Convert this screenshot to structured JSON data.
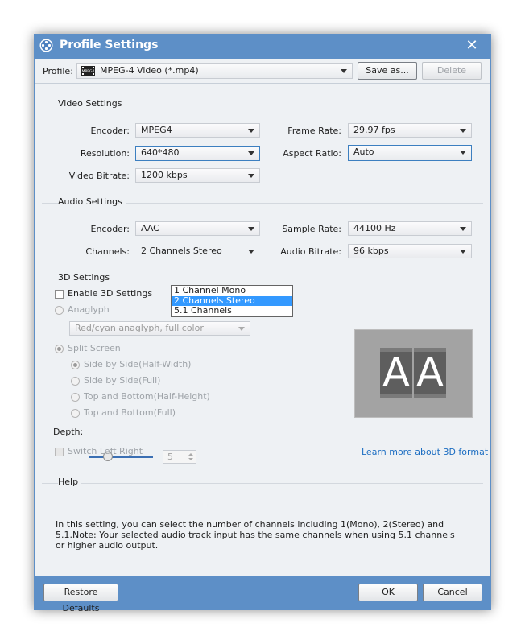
{
  "window": {
    "title": "Profile Settings"
  },
  "profile": {
    "label": "Profile:",
    "value": "MPEG-4 Video (*.mp4)",
    "icon_text": "MPEG4",
    "save_as": "Save as...",
    "delete": "Delete"
  },
  "video": {
    "title": "Video Settings",
    "encoder_label": "Encoder:",
    "encoder": "MPEG4",
    "resolution_label": "Resolution:",
    "resolution": "640*480",
    "bitrate_label": "Video Bitrate:",
    "bitrate": "1200 kbps",
    "framerate_label": "Frame Rate:",
    "framerate": "29.97 fps",
    "aspect_label": "Aspect Ratio:",
    "aspect": "Auto"
  },
  "audio": {
    "title": "Audio Settings",
    "encoder_label": "Encoder:",
    "encoder": "AAC",
    "channels_label": "Channels:",
    "channels": "2 Channels Stereo",
    "samplerate_label": "Sample Rate:",
    "samplerate": "44100 Hz",
    "bitrate_label": "Audio Bitrate:",
    "bitrate": "96 kbps",
    "channel_options": [
      "1 Channel Mono",
      "2 Channels Stereo",
      "5.1 Channels"
    ],
    "highlighted_option": "2 Channels Stereo"
  },
  "three_d": {
    "title": "3D Settings",
    "enable": "Enable 3D Settings",
    "anaglyph": "Anaglyph",
    "anaglyph_mode": "Red/cyan anaglyph, full color",
    "split_screen": "Split Screen",
    "options": [
      "Side by Side(Half-Width)",
      "Side by Side(Full)",
      "Top and Bottom(Half-Height)",
      "Top and Bottom(Full)"
    ],
    "depth_label": "Depth:",
    "depth_value": "5",
    "depth_level": 0.3,
    "switch": "Switch Left Right",
    "learn_more": "Learn more about 3D format",
    "preview_letters": [
      "A",
      "A"
    ]
  },
  "help": {
    "title": "Help",
    "text": "In this setting, you can select the number of channels including 1(Mono), 2(Stereo) and 5.1.Note: Your selected audio track input has the same channels when using 5.1 channels or higher audio output."
  },
  "footer": {
    "restore": "Restore Defaults",
    "ok": "OK",
    "cancel": "Cancel"
  },
  "colors": {
    "title_bar": "#5d8fc7",
    "client": "#eef1f4",
    "highlight": "#3399ff",
    "link": "#1d6ec2"
  }
}
